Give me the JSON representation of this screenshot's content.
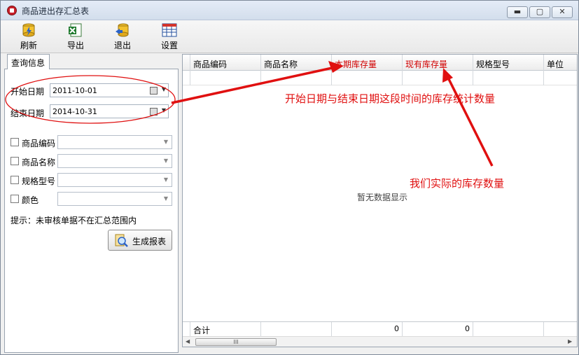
{
  "window": {
    "title": "商品进出存汇总表",
    "min": "▬",
    "max": "▢",
    "close": "✕"
  },
  "toolbar": {
    "refresh": "刷新",
    "export": "导出",
    "exit": "退出",
    "settings": "设置"
  },
  "query": {
    "tab": "查询信息",
    "start_label": "开始日期",
    "start_value": "2011-10-01",
    "end_label": "结束日期",
    "end_value": "2014-10-31",
    "filters": [
      {
        "label": "商品编码"
      },
      {
        "label": "商品名称"
      },
      {
        "label": "规格型号"
      },
      {
        "label": "颜色"
      }
    ],
    "hint": "提示：未审核单据不在汇总范围内",
    "generate": "生成报表"
  },
  "grid": {
    "columns": [
      "商品编码",
      "商品名称",
      "本期库存量",
      "现有库存量",
      "规格型号",
      "单位"
    ],
    "empty_text": "暂无数据显示",
    "footer": {
      "label": "合计",
      "period_total": "0",
      "current_total": "0"
    },
    "scroll_thumb": "III"
  },
  "annotations": {
    "period": "开始日期与结束日期这段时间的库存统计数量",
    "current": "我们实际的库存数量"
  },
  "colors": {
    "annotation": "#e01010",
    "highlight_header": "#d00000"
  }
}
